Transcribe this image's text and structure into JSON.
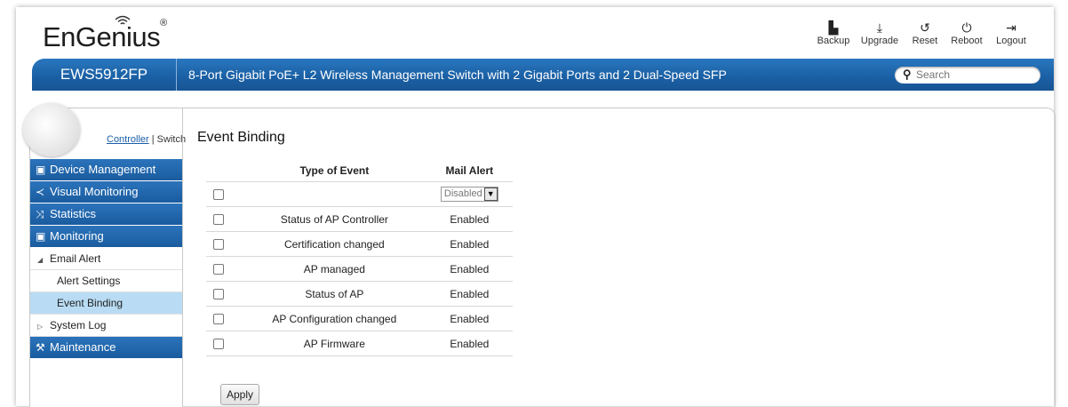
{
  "brand": {
    "logo_text": "EnGenius",
    "trademark": "®"
  },
  "toolbar": [
    {
      "label": "Backup",
      "icon": "save-icon"
    },
    {
      "label": "Upgrade",
      "icon": "upload-icon"
    },
    {
      "label": "Reset",
      "icon": "reset-icon"
    },
    {
      "label": "Reboot",
      "icon": "power-icon"
    },
    {
      "label": "Logout",
      "icon": "logout-icon"
    }
  ],
  "header": {
    "model": "EWS5912FP",
    "description": "8-Port Gigabit PoE+ L2 Wireless Management Switch with 2 Gigabit Ports and 2 Dual-Speed SFP",
    "search_placeholder": "Search"
  },
  "mode": {
    "controller": "Controller",
    "separator": "|",
    "switch": "Switch"
  },
  "sidebar": {
    "items": [
      {
        "label": "Device Management",
        "icon": "device-icon"
      },
      {
        "label": "Visual Monitoring",
        "icon": "share-icon"
      },
      {
        "label": "Statistics",
        "icon": "statistics-icon"
      },
      {
        "label": "Monitoring",
        "icon": "monitor-icon"
      }
    ],
    "email_alert": "Email Alert",
    "alert_settings": "Alert Settings",
    "event_binding": "Event Binding",
    "system_log": "System Log",
    "maintenance": "Maintenance"
  },
  "main": {
    "title": "Event Binding",
    "col_type": "Type of Event",
    "col_mail": "Mail Alert",
    "select_value": "Disabled",
    "rows": [
      {
        "event": "Status of AP Controller",
        "mail": "Enabled"
      },
      {
        "event": "Certification changed",
        "mail": "Enabled"
      },
      {
        "event": "AP managed",
        "mail": "Enabled"
      },
      {
        "event": "Status of AP",
        "mail": "Enabled"
      },
      {
        "event": "AP Configuration changed",
        "mail": "Enabled"
      },
      {
        "event": "AP Firmware",
        "mail": "Enabled"
      }
    ],
    "apply_label": "Apply"
  },
  "colors": {
    "accent_blue": "#1a5fa3",
    "active_row": "#b9dcf4"
  }
}
